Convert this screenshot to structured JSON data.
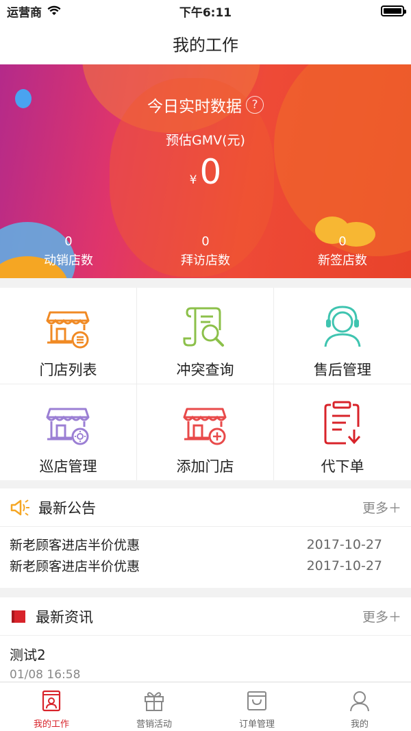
{
  "status_bar": {
    "carrier": "运营商",
    "time": "下午6:11"
  },
  "nav": {
    "title": "我的工作"
  },
  "hero": {
    "title": "今日实时数据",
    "help_symbol": "?",
    "gmv_label": "预估GMV(元)",
    "gmv_currency": "¥",
    "gmv_value": "0",
    "stats": [
      {
        "value": "0",
        "label": "动销店数"
      },
      {
        "value": "0",
        "label": "拜访店数"
      },
      {
        "value": "0",
        "label": "新签店数"
      }
    ]
  },
  "grid": {
    "items": [
      {
        "label": "门店列表",
        "icon": "store-list-icon"
      },
      {
        "label": "冲突查询",
        "icon": "conflict-search-icon"
      },
      {
        "label": "售后管理",
        "icon": "customer-service-icon"
      },
      {
        "label": "巡店管理",
        "icon": "store-patrol-icon"
      },
      {
        "label": "添加门店",
        "icon": "add-store-icon"
      },
      {
        "label": "代下单",
        "icon": "place-order-icon"
      }
    ]
  },
  "notices": {
    "title": "最新公告",
    "more": "更多＋",
    "items": [
      {
        "text": "新老顾客进店半价优惠",
        "date": "2017-10-27"
      },
      {
        "text": "新老顾客进店半价优惠",
        "date": "2017-10-27"
      }
    ]
  },
  "news": {
    "title": "最新资讯",
    "more": "更多＋",
    "items": [
      {
        "title": "测试2",
        "time": "01/08 16:58"
      }
    ]
  },
  "tabs": [
    {
      "label": "我的工作",
      "active": true
    },
    {
      "label": "营销活动",
      "active": false
    },
    {
      "label": "订单管理",
      "active": false
    },
    {
      "label": "我的",
      "active": false
    }
  ],
  "colors": {
    "accent": "#d8232a",
    "orange": "#f08a24",
    "green": "#8cc04a",
    "teal": "#3fc4b0",
    "purple": "#9b7fd4",
    "red": "#e84a4a"
  }
}
